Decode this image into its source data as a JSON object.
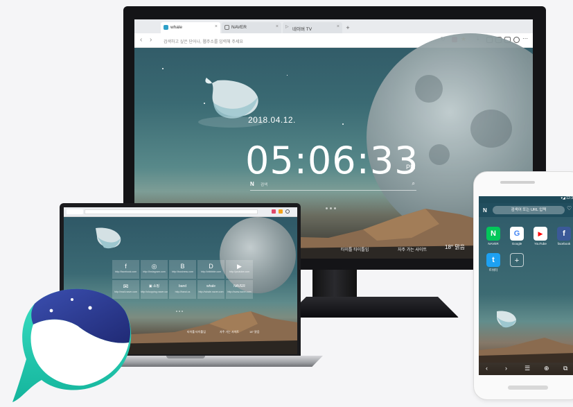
{
  "monitor": {
    "tabs": [
      {
        "label": "whale",
        "icon": "whale-icon",
        "active": true
      },
      {
        "label": "NAVER",
        "icon": "page-icon",
        "active": false
      },
      {
        "label": "네이버 TV",
        "icon": "play-icon",
        "active": false
      }
    ],
    "new_tab": "+",
    "tab_close": "×",
    "nav_back": "‹",
    "nav_forward": "›",
    "address_placeholder": "검색하고 싶은 단어나, 웹주소를 입력해 주세요",
    "date": "2018.04.12.",
    "clock": "05:06:33",
    "ampm": "PM",
    "search_logo": "N",
    "search_placeholder": "검색",
    "search_icon": "⌕",
    "bottom_links": [
      "타이틀 타이틀입",
      "자주 가는 사이트"
    ],
    "weather": "18° 맑음"
  },
  "laptop": {
    "tiles": [
      {
        "glyph": "f",
        "url": "http://facebook.com"
      },
      {
        "glyph": "◎",
        "url": "http://instagram.com"
      },
      {
        "glyph": "B",
        "url": "http://business.com"
      },
      {
        "glyph": "D",
        "url": "http://dribbble.com"
      },
      {
        "glyph": "▶",
        "url": "http://youtube.com"
      },
      {
        "glyph": "✉",
        "url": "http://mail.naver.com"
      },
      {
        "glyph": "▣ 쇼핑",
        "url": "http://shopping.naver.com"
      },
      {
        "glyph": "band",
        "url": "http://band.us"
      },
      {
        "glyph": "whale",
        "url": "http://whale.naver.com"
      },
      {
        "glyph": "NAVER",
        "url": "http://www.naver.com"
      }
    ],
    "bottom_links": [
      "타이틀 타이틀입",
      "자주 가는 사이트",
      "18° 맑음"
    ]
  },
  "phone": {
    "status": "▾◢ 12:3",
    "logo": "N",
    "search_placeholder": "검색어 또는 URL 입력",
    "apps": [
      {
        "letter": "N",
        "label": "NAVER",
        "color": "#03c75a"
      },
      {
        "letter": "G",
        "label": "Google",
        "color": "#ffffff"
      },
      {
        "letter": "▶",
        "label": "YouTube",
        "color": "#ff0000"
      },
      {
        "letter": "f",
        "label": "facebook",
        "color": "#3b5998"
      },
      {
        "letter": "t",
        "label": "트위터",
        "color": "#1da1f2"
      },
      {
        "letter": "+",
        "label": "",
        "color": "transparent"
      }
    ],
    "nav_icons": [
      "‹",
      "›",
      "☰",
      "⊕",
      "⧉"
    ]
  },
  "colors": {
    "whale_teal": "#1ec8b0",
    "whale_navy": "#2a3890",
    "sky_top": "#2e5563"
  }
}
